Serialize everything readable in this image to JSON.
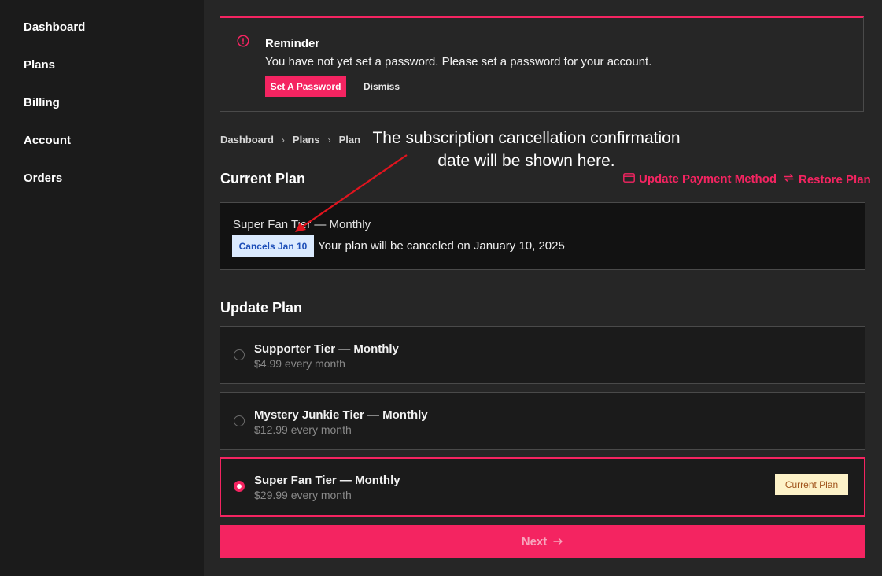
{
  "sidebar": {
    "items": [
      {
        "label": "Dashboard"
      },
      {
        "label": "Plans"
      },
      {
        "label": "Billing"
      },
      {
        "label": "Account"
      },
      {
        "label": "Orders"
      }
    ]
  },
  "reminder": {
    "icon": "info-circle-icon",
    "title": "Reminder",
    "message": "You have not yet set a password. Please set a password for your account.",
    "set_password_label": "Set A Password",
    "dismiss_label": "Dismiss"
  },
  "breadcrumb": [
    "Dashboard",
    "Plans",
    "Plan"
  ],
  "annotation": {
    "line1": "The subscription cancellation confirmation",
    "line2": "date will be shown here."
  },
  "current_plan": {
    "title": "Current Plan",
    "update_payment_label": "Update Payment Method",
    "restore_plan_label": "Restore Plan",
    "plan_name": "Super Fan Tier — Monthly",
    "cancel_badge": "Cancels Jan 10",
    "cancel_message": "Your plan will be canceled on January 10, 2025"
  },
  "update_plan": {
    "title": "Update Plan",
    "options": [
      {
        "name": "Supporter Tier — Monthly",
        "price": "$4.99 every month"
      },
      {
        "name": "Mystery Junkie Tier — Monthly",
        "price": "$12.99 every month"
      },
      {
        "name": "Super Fan Tier — Monthly",
        "price": "$29.99 every month",
        "tag": "Current Plan"
      }
    ]
  },
  "next_label": "Next",
  "colors": {
    "accent": "#f42461",
    "badge_bg": "#dbeafe",
    "badge_text": "#1e4fb8",
    "current_tag_bg": "#fdf2c8",
    "current_tag_text": "#a0531b",
    "annotation_arrow": "#e0141e"
  }
}
